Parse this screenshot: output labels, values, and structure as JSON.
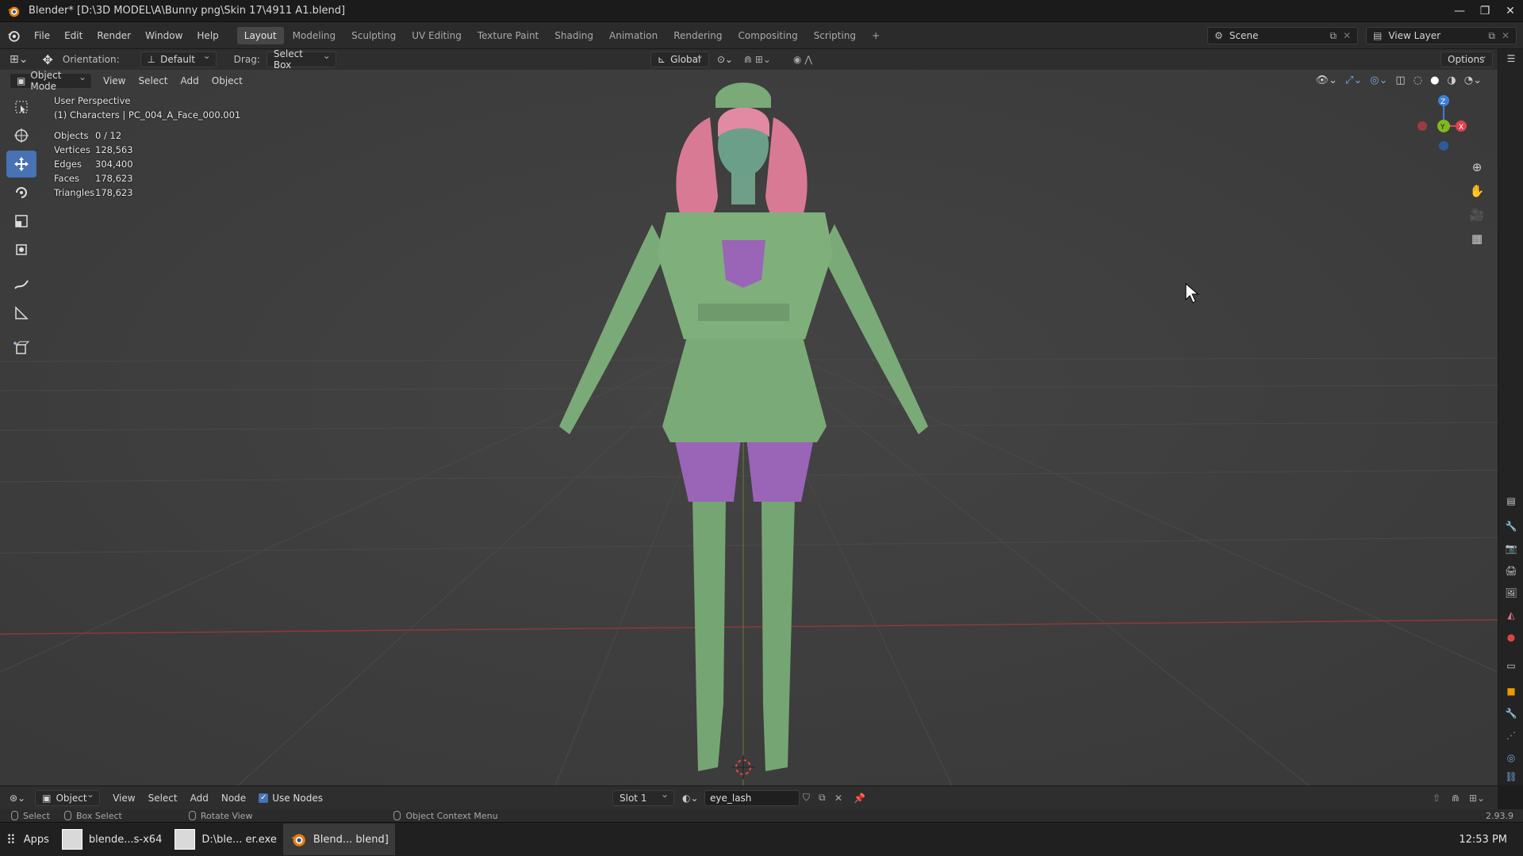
{
  "window": {
    "title": "Blender* [D:\\3D MODEL\\A\\Bunny png\\Skin 17\\4911 A1.blend]",
    "controls": [
      "minimize-icon",
      "maximize-icon",
      "close-icon"
    ]
  },
  "menu": {
    "items": [
      "File",
      "Edit",
      "Render",
      "Window",
      "Help"
    ]
  },
  "workspaces": {
    "tabs": [
      "Layout",
      "Modeling",
      "Sculpting",
      "UV Editing",
      "Texture Paint",
      "Shading",
      "Animation",
      "Rendering",
      "Compositing",
      "Scripting"
    ],
    "active": "Layout",
    "add_label": "+"
  },
  "scene": {
    "name": "Scene"
  },
  "view_layer": {
    "name": "View Layer"
  },
  "tool_header": {
    "orientation_label": "Orientation:",
    "orientation_value": "Default",
    "drag_label": "Drag:",
    "drag_value": "Select Box",
    "transform_orientation": "Global",
    "options_label": "Options"
  },
  "viewport_header": {
    "mode": "Object Mode",
    "menus": [
      "View",
      "Select",
      "Add",
      "Object"
    ]
  },
  "viewport": {
    "perspective": "User Perspective",
    "active_object": "(1) Characters | PC_004_A_Face_000.001",
    "stats": [
      {
        "label": "Objects",
        "value": "0 / 12"
      },
      {
        "label": "Vertices",
        "value": "128,563"
      },
      {
        "label": "Edges",
        "value": "304,400"
      },
      {
        "label": "Faces",
        "value": "178,623"
      },
      {
        "label": "Triangles",
        "value": "178,623"
      }
    ],
    "gizmo_axes": [
      "Z",
      "Y",
      "X"
    ]
  },
  "toolbar": {
    "tools": [
      "select-box-icon",
      "cursor-icon",
      "move-icon",
      "rotate-icon",
      "scale-icon",
      "transform-icon",
      "annotate-icon",
      "measure-icon",
      "add-cube-icon"
    ],
    "active": "move-icon"
  },
  "shader_header": {
    "editor_type": "Object",
    "menus": [
      "View",
      "Select",
      "Add",
      "Node"
    ],
    "use_nodes_label": "Use Nodes",
    "use_nodes_checked": true,
    "slot": "Slot 1",
    "material": "eye_lash"
  },
  "status_bar": {
    "hints": [
      "Select",
      "Box Select",
      "Rotate View",
      "Object Context Menu"
    ],
    "version": "2.93.9"
  },
  "taskbar": {
    "apps_label": "Apps",
    "items": [
      "blende...s-x64",
      "D:\\ble... er.exe",
      "Blend... blend]"
    ],
    "active_index": 2,
    "clock": "12:53 PM"
  },
  "colors": {
    "accent": "#4772b3",
    "viewport_bg": "#3d3d3d",
    "x_axis": "#e0424e",
    "y_axis": "#82b81e",
    "z_axis": "#3d7fd6"
  }
}
